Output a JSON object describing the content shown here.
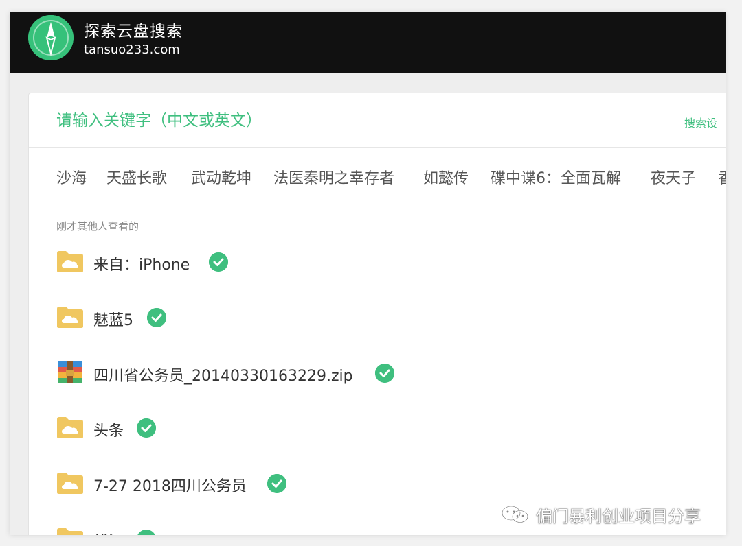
{
  "header": {
    "site_name": "探索云盘搜索",
    "site_domain": "tansuo233.com",
    "brand_color": "#36c17a"
  },
  "search": {
    "placeholder": "请输入关键字（中文或英文）",
    "settings_label": "搜索设"
  },
  "hot_tags": [
    "沙海",
    "天盛长歌",
    "武动乾坤",
    "法医秦明之幸存者",
    "如懿传",
    "碟中谍6：全面瓦解",
    "夜天子",
    "香"
  ],
  "recent": {
    "title": "刚才其他人查看的",
    "items": [
      {
        "name": "来自：iPhone",
        "icon": "folder-icon",
        "verified": true
      },
      {
        "name": "魅蓝5",
        "icon": "folder-icon",
        "verified": true
      },
      {
        "name": "四川省公务员_20140330163229.zip",
        "icon": "zip-archive-icon",
        "verified": true
      },
      {
        "name": "头条",
        "icon": "folder-icon",
        "verified": true
      },
      {
        "name": "7-27 2018四川公务员",
        "icon": "folder-icon",
        "verified": true
      },
      {
        "name": "錢江",
        "icon": "folder-icon",
        "verified": true
      }
    ]
  },
  "watermark": {
    "text": "偏门暴利创业项目分享"
  },
  "colors": {
    "accent": "#3fbf7f",
    "header_bg": "#111111",
    "folder": "#f0c760"
  }
}
